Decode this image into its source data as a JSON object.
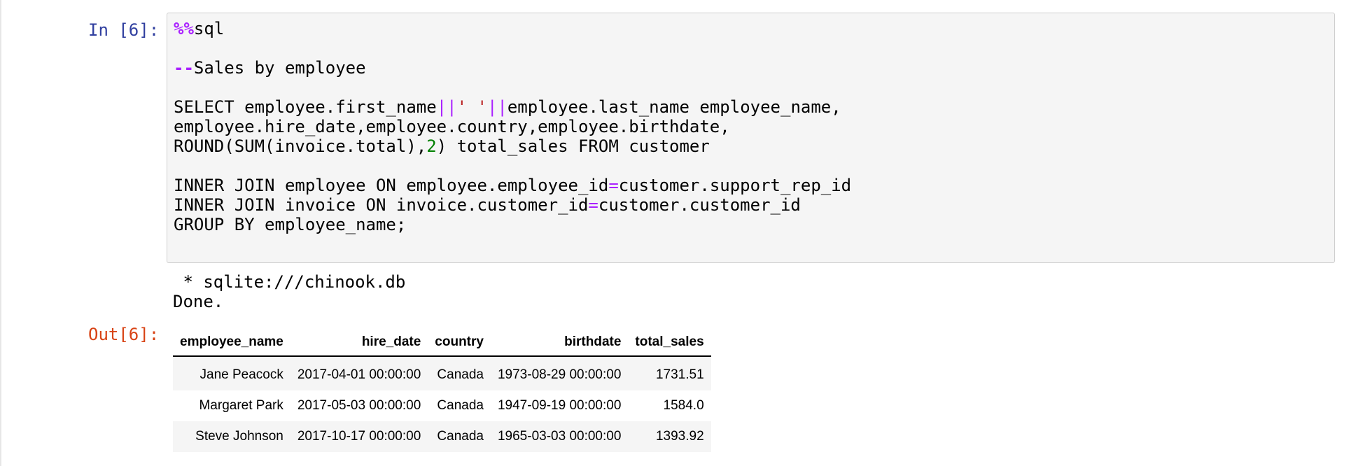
{
  "cell": {
    "input_prompt": "In [6]:",
    "output_prompt": "Out[6]:",
    "code_lines": [
      [
        {
          "t": "%%",
          "c": "magic"
        },
        {
          "t": "sql",
          "c": ""
        }
      ],
      [],
      [
        {
          "t": "--",
          "c": "commentop"
        },
        {
          "t": "Sales by employee",
          "c": ""
        }
      ],
      [],
      [
        {
          "t": "SELECT employee.first_name",
          "c": ""
        },
        {
          "t": "||",
          "c": "op"
        },
        {
          "t": "' '",
          "c": "str"
        },
        {
          "t": "||",
          "c": "op"
        },
        {
          "t": "employee.last_name employee_name,",
          "c": ""
        }
      ],
      [
        {
          "t": "employee.hire_date,employee.country,employee.birthdate,",
          "c": ""
        }
      ],
      [
        {
          "t": "ROUND(SUM(invoice.total),",
          "c": ""
        },
        {
          "t": "2",
          "c": "num"
        },
        {
          "t": ") total_sales FROM customer",
          "c": ""
        }
      ],
      [],
      [
        {
          "t": "INNER JOIN employee ON employee.employee_id",
          "c": ""
        },
        {
          "t": "=",
          "c": "op"
        },
        {
          "t": "customer.support_rep_id",
          "c": ""
        }
      ],
      [
        {
          "t": "INNER JOIN invoice ON invoice.customer_id",
          "c": ""
        },
        {
          "t": "=",
          "c": "op"
        },
        {
          "t": "customer.customer_id",
          "c": ""
        }
      ],
      [
        {
          "t": "GROUP BY employee_name;",
          "c": ""
        }
      ]
    ],
    "stdout_lines": [
      " * sqlite:///chinook.db",
      "Done."
    ]
  },
  "table": {
    "columns": [
      {
        "label": "employee_name",
        "align": "left"
      },
      {
        "label": "hire_date",
        "align": "right"
      },
      {
        "label": "country",
        "align": "left"
      },
      {
        "label": "birthdate",
        "align": "right"
      },
      {
        "label": "total_sales",
        "align": "right"
      }
    ],
    "rows": [
      [
        "Jane Peacock",
        "2017-04-01 00:00:00",
        "Canada",
        "1973-08-29 00:00:00",
        "1731.51"
      ],
      [
        "Margaret Park",
        "2017-05-03 00:00:00",
        "Canada",
        "1947-09-19 00:00:00",
        "1584.0"
      ],
      [
        "Steve Johnson",
        "2017-10-17 00:00:00",
        "Canada",
        "1965-03-03 00:00:00",
        "1393.92"
      ]
    ]
  }
}
